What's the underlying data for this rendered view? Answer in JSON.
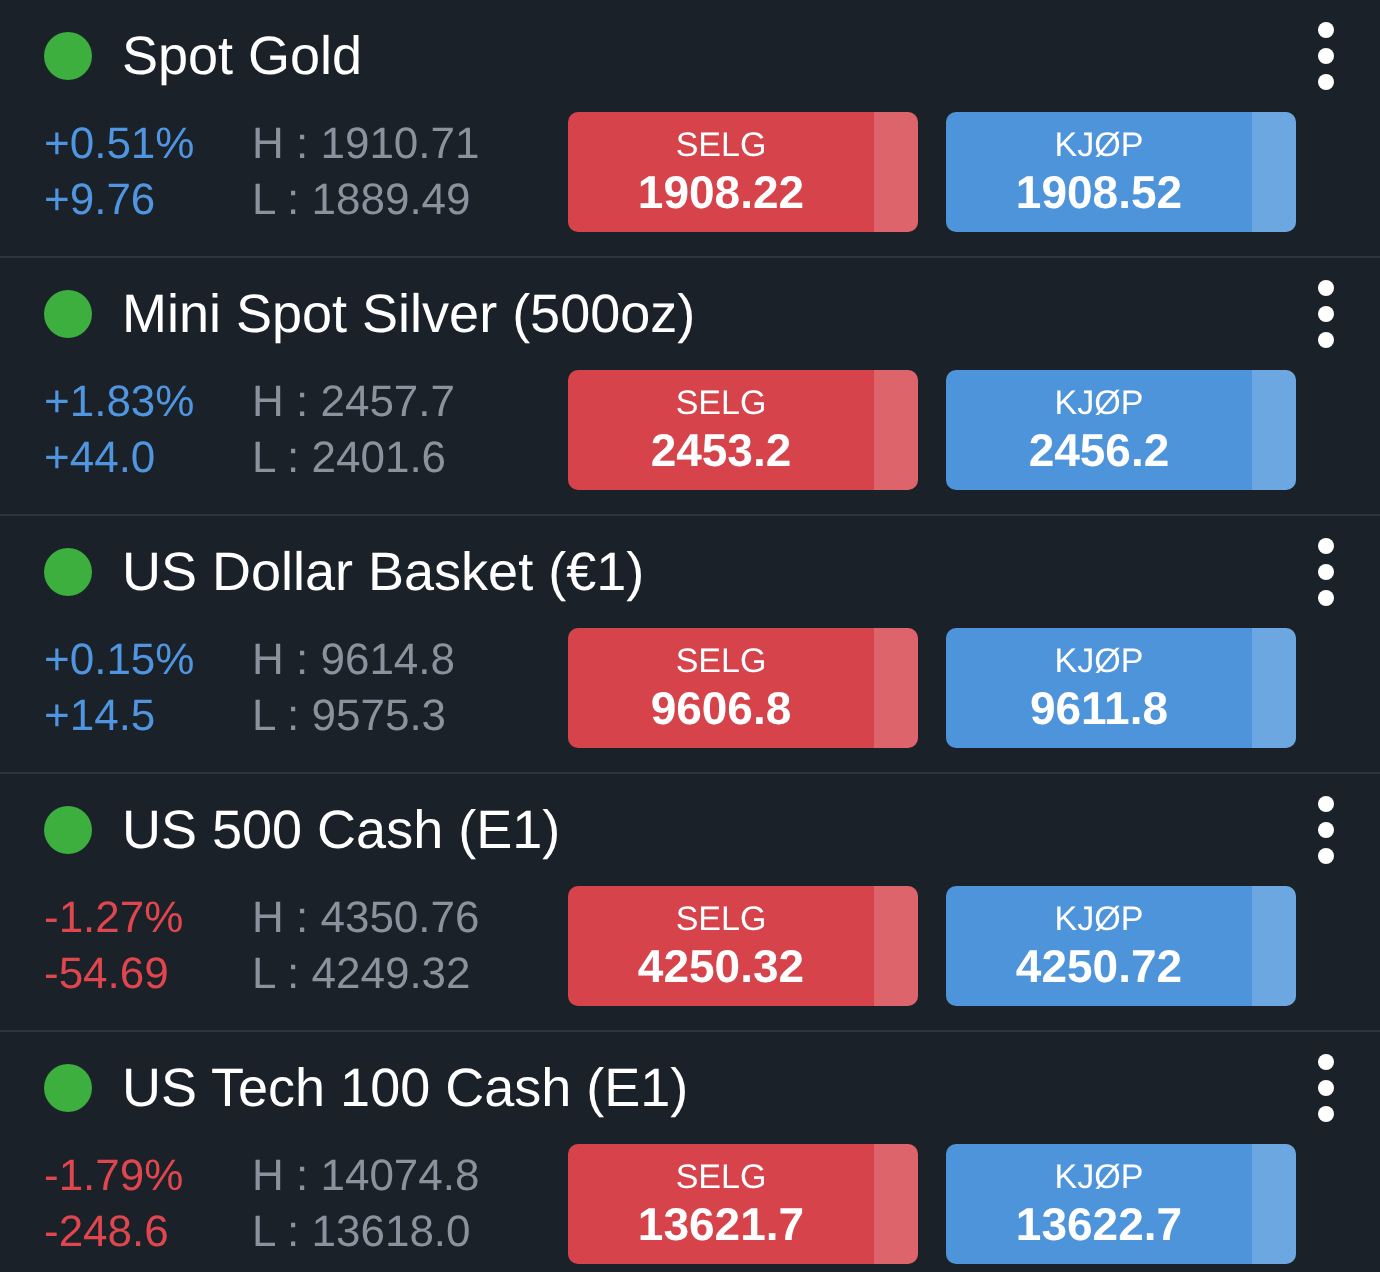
{
  "instruments": [
    {
      "name": "Spot Gold",
      "market_open": true,
      "rising": true,
      "change_pct": "+0.51%",
      "change": "+9.76",
      "high": "H : 1910.71",
      "low": "L : 1889.49",
      "sell": {
        "label": "SELG",
        "price": "1908.22"
      },
      "buy": {
        "label": "KJØP",
        "price": "1908.52"
      }
    },
    {
      "name": "Mini Spot Silver (500oz)",
      "market_open": true,
      "rising": true,
      "change_pct": "+1.83%",
      "change": "+44.0",
      "high": "H : 2457.7",
      "low": "L : 2401.6",
      "sell": {
        "label": "SELG",
        "price": "2453.2"
      },
      "buy": {
        "label": "KJØP",
        "price": "2456.2"
      }
    },
    {
      "name": "US Dollar Basket (€1)",
      "market_open": true,
      "rising": true,
      "change_pct": "+0.15%",
      "change": "+14.5",
      "high": "H : 9614.8",
      "low": "L : 9575.3",
      "sell": {
        "label": "SELG",
        "price": "9606.8"
      },
      "buy": {
        "label": "KJØP",
        "price": "9611.8"
      }
    },
    {
      "name": "US 500 Cash (E1)",
      "market_open": true,
      "rising": false,
      "change_pct": "-1.27%",
      "change": "-54.69",
      "high": "H : 4350.76",
      "low": "L : 4249.32",
      "sell": {
        "label": "SELG",
        "price": "4250.32"
      },
      "buy": {
        "label": "KJØP",
        "price": "4250.72"
      }
    },
    {
      "name": "US Tech 100 Cash (E1)",
      "market_open": true,
      "rising": false,
      "change_pct": "-1.79%",
      "change": "-248.6",
      "high": "H : 14074.8",
      "low": "L : 13618.0",
      "sell": {
        "label": "SELG",
        "price": "13621.7"
      },
      "buy": {
        "label": "KJØP",
        "price": "13622.7"
      }
    }
  ]
}
